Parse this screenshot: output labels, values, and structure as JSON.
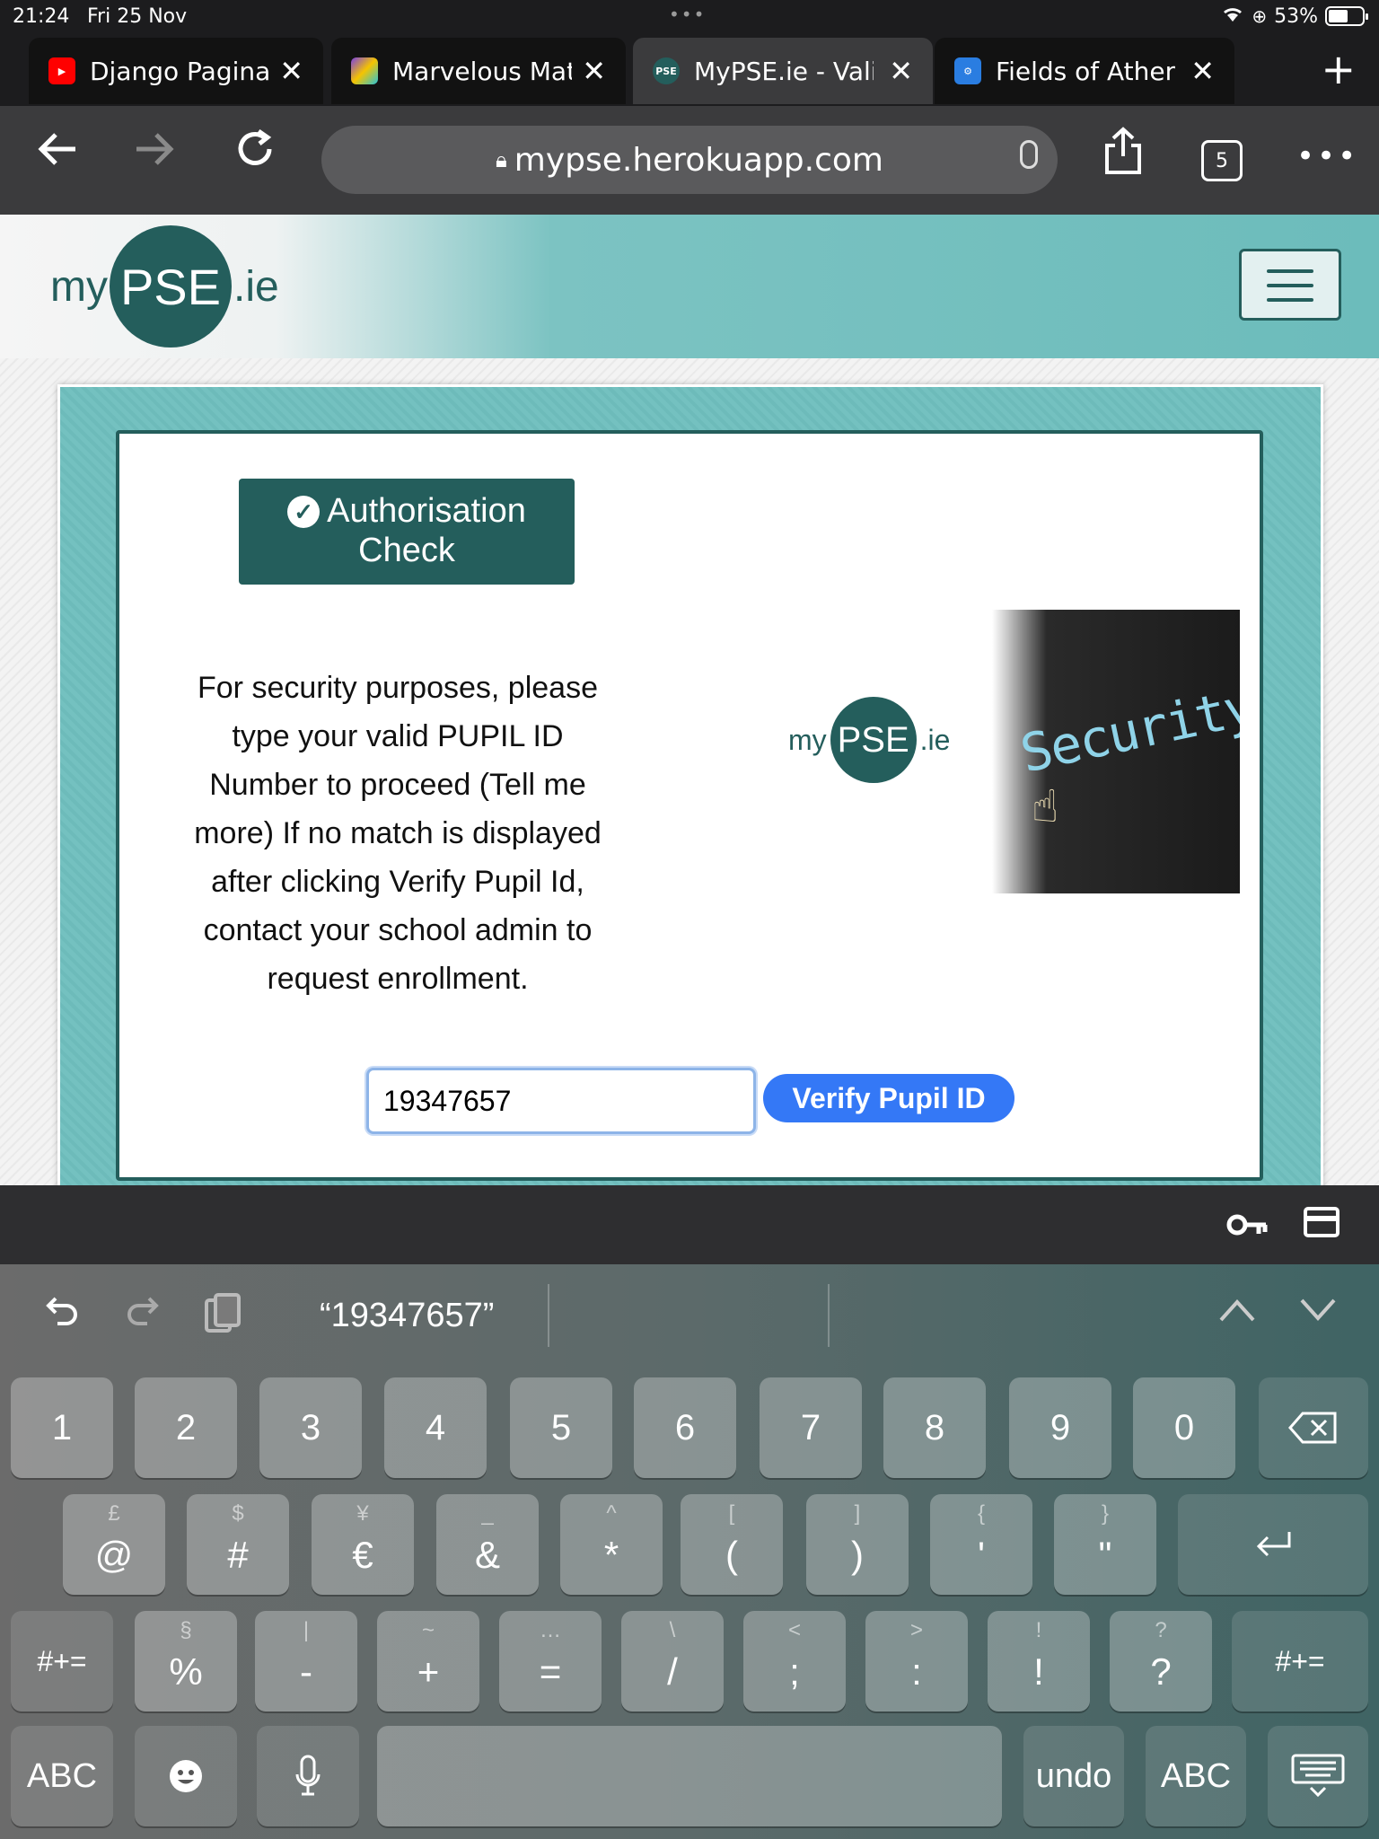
{
  "status_bar": {
    "time": "21:24",
    "date": "Fri 25 Nov",
    "battery": "53%"
  },
  "tabs": [
    {
      "title": "Django Paginat",
      "favicon": "youtube-icon",
      "color": "#ff0000"
    },
    {
      "title": "Marvelous Matc",
      "favicon": "marvelous-icon",
      "color": "#7b3fe4"
    },
    {
      "title": "MyPSE.ie - Vali",
      "favicon": "pse-icon",
      "color": "#245e5c",
      "active": true
    },
    {
      "title": "Fields of Athen",
      "favicon": "fields-icon",
      "color": "#2a7de1"
    }
  ],
  "toolbar": {
    "url": "mypse.herokuapp.com",
    "tab_count": "5"
  },
  "site": {
    "logo": {
      "my": "my",
      "pse": "PSE",
      "ie": ".ie"
    },
    "auth_button": "Authorisation Check",
    "auth_line1": "Authorisation",
    "auth_line2": "Check",
    "message": "For security purposes, please type your valid PUPIL ID Number to proceed (Tell me more) If no match is displayed after clicking Verify Pupil Id, contact your school admin to request enrollment.",
    "security_image_text": "Security",
    "pupil_id_value": "19347657",
    "verify_button": "Verify Pupil ID"
  },
  "keyboard": {
    "suggestion": "“19347657”",
    "row1": [
      "1",
      "2",
      "3",
      "4",
      "5",
      "6",
      "7",
      "8",
      "9",
      "0"
    ],
    "row2": [
      {
        "main": "@",
        "alt": "£"
      },
      {
        "main": "#",
        "alt": "$"
      },
      {
        "main": "€",
        "alt": "¥"
      },
      {
        "main": "&",
        "alt": "_"
      },
      {
        "main": "*",
        "alt": "^"
      },
      {
        "main": "(",
        "alt": "["
      },
      {
        "main": ")",
        "alt": "]"
      },
      {
        "main": "'",
        "alt": "{"
      },
      {
        "main": "\"",
        "alt": "}"
      }
    ],
    "row3": [
      {
        "main": "%",
        "alt": "§"
      },
      {
        "main": "-",
        "alt": "|"
      },
      {
        "main": "+",
        "alt": "~"
      },
      {
        "main": "=",
        "alt": "…"
      },
      {
        "main": "/",
        "alt": "\\"
      },
      {
        "main": ";",
        "alt": "<"
      },
      {
        "main": ":",
        "alt": ">"
      },
      {
        "main": "!",
        "alt": "!"
      },
      {
        "main": "?",
        "alt": "?"
      }
    ],
    "symbols_key": "#+=",
    "abc_key": "ABC",
    "undo_key": "undo"
  }
}
